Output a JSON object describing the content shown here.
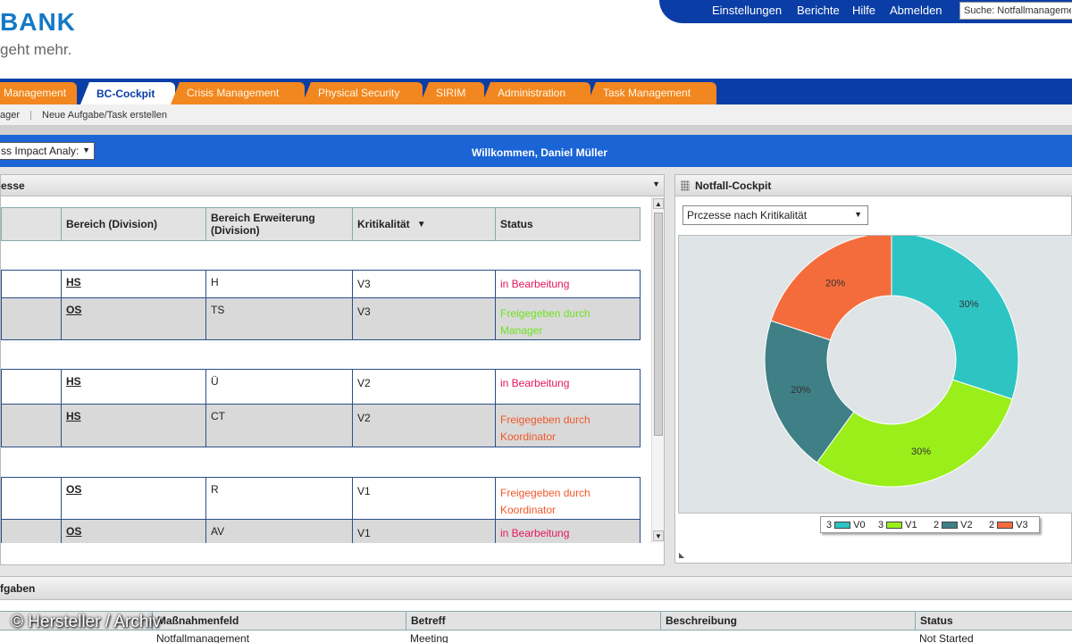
{
  "brand": {
    "name": "BANK",
    "slogan": "geht mehr."
  },
  "topnav": {
    "items": [
      "Einstellungen",
      "Berichte",
      "Hilfe",
      "Abmelden"
    ],
    "search_value": "Suche: Notfallmanageme"
  },
  "tabs": [
    {
      "label": "Management",
      "active": false
    },
    {
      "label": "BC-Cockpit",
      "active": true
    },
    {
      "label": "Crisis Management",
      "active": false
    },
    {
      "label": "Physical Security",
      "active": false
    },
    {
      "label": "SIRIM",
      "active": false
    },
    {
      "label": "Administration",
      "active": false
    },
    {
      "label": "Task Management",
      "active": false
    }
  ],
  "subnav": {
    "item1": "ager",
    "item2": "Neue Aufgabe/Task erstellen"
  },
  "welcome": {
    "selector_value": "ss Impact Analy:",
    "text": "Willkommen, Daniel Müller"
  },
  "processes": {
    "title": "esse",
    "columns": [
      "Bereich (Division)",
      "Bereich Erweiterung (Division)",
      "Kritikalität",
      "Status"
    ],
    "rows": [
      {
        "bereich": "HS",
        "erweiterung": "H",
        "krit": "V3",
        "status": "in Bearbeitung"
      },
      {
        "bereich": "OS",
        "erweiterung": "TS",
        "krit": "V3",
        "status": "Freigegeben durch Manager"
      },
      {
        "bereich": "HS",
        "erweiterung": "Ü",
        "krit": "V2",
        "status": "in Bearbeitung"
      },
      {
        "bereich": "HS",
        "erweiterung": "CT",
        "krit": "V2",
        "status": "Freigegeben durch Koordinator"
      },
      {
        "bereich": "OS",
        "erweiterung": "R",
        "krit": "V1",
        "status": "Freigegeben durch Koordinator"
      },
      {
        "bereich": "OS",
        "erweiterung": "AV",
        "krit": "V1",
        "status": "in Bearbeitung"
      }
    ]
  },
  "cockpit": {
    "title": "Notfall-Cockpit",
    "selector_value": "Prczesse nach Kritikalität"
  },
  "chart_data": {
    "type": "pie",
    "donut": true,
    "categories": [
      "V0",
      "V1",
      "V2",
      "V3"
    ],
    "values": [
      3,
      3,
      2,
      2
    ],
    "percent_labels": [
      "30%",
      "30%",
      "20%",
      "20%"
    ],
    "colors": [
      "#2fc4c4",
      "#9aee1a",
      "#3f7f86",
      "#f56c3c"
    ],
    "legend": [
      {
        "count": "3",
        "label": "V0"
      },
      {
        "count": "3",
        "label": "V1"
      },
      {
        "count": "2",
        "label": "V2"
      },
      {
        "count": "2",
        "label": "V3"
      }
    ],
    "legend_position": "bottom"
  },
  "tasks": {
    "title": "fgaben",
    "columns": [
      "Maßnahmenfeld",
      "Betreff",
      "Beschreibung",
      "Status"
    ],
    "row": {
      "feld": "Notfallmanagement",
      "betreff": "Meeting",
      "beschreibung": "",
      "status": "Not Started"
    }
  },
  "watermark": "© Hersteller / Archiv"
}
